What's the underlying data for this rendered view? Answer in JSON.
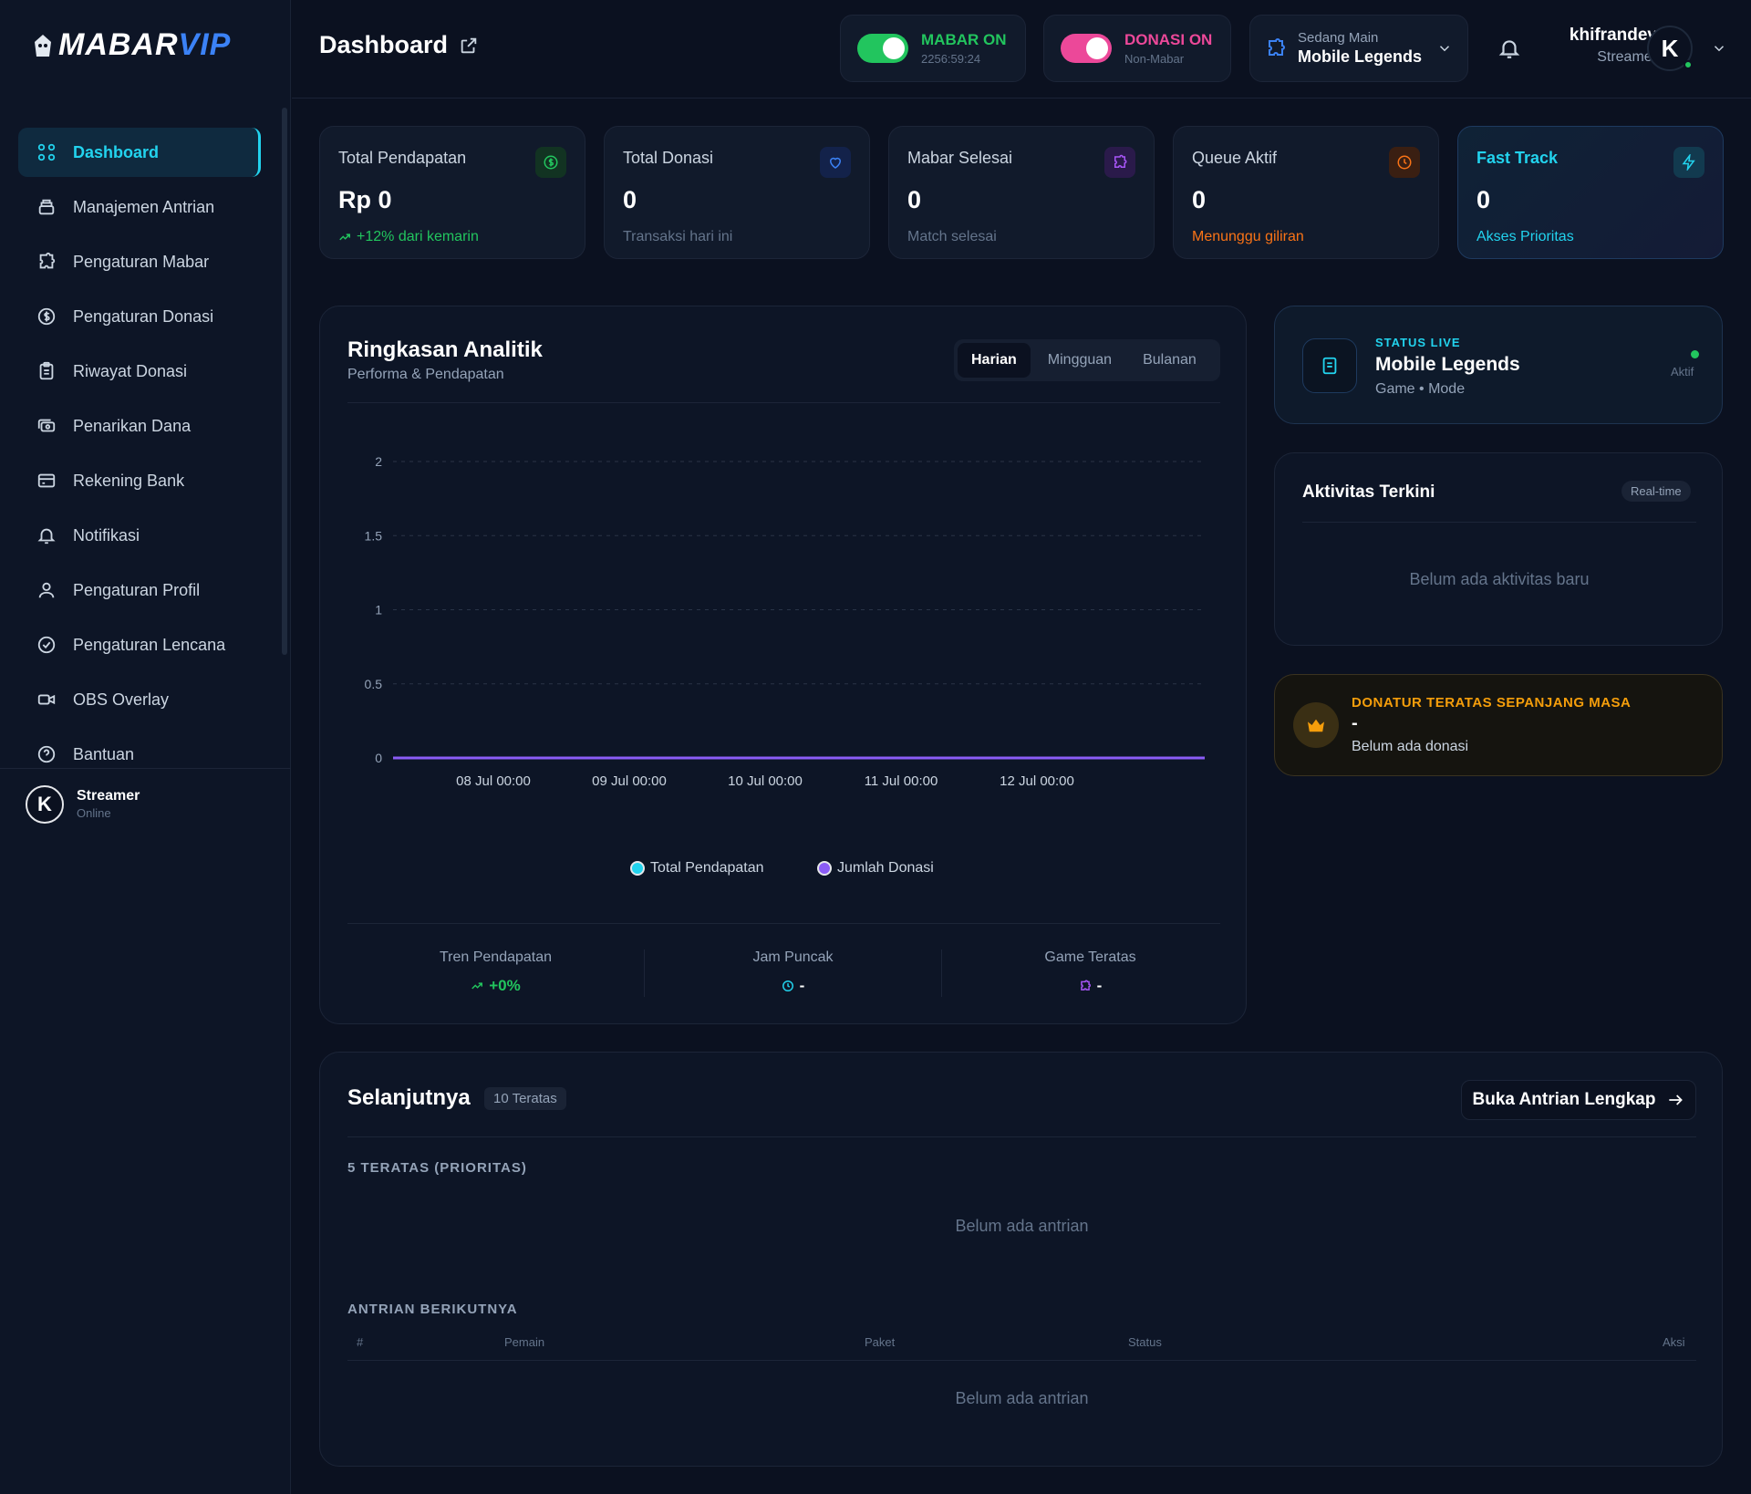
{
  "brand": {
    "logo_a": "MABAR",
    "logo_b": "VIP"
  },
  "sidebar": {
    "items": [
      {
        "label": "Dashboard",
        "icon": "grid-icon"
      },
      {
        "label": "Manajemen Antrian",
        "icon": "stack-icon"
      },
      {
        "label": "Pengaturan Mabar",
        "icon": "puzzle-icon"
      },
      {
        "label": "Pengaturan Donasi",
        "icon": "dollar-circle-icon"
      },
      {
        "label": "Riwayat Donasi",
        "icon": "clipboard-icon"
      },
      {
        "label": "Penarikan Dana",
        "icon": "cash-icon"
      },
      {
        "label": "Rekening Bank",
        "icon": "card-icon"
      },
      {
        "label": "Notifikasi",
        "icon": "bell-icon"
      },
      {
        "label": "Pengaturan Profil",
        "icon": "user-icon"
      },
      {
        "label": "Pengaturan Lencana",
        "icon": "badge-check-icon"
      },
      {
        "label": "OBS Overlay",
        "icon": "video-icon"
      },
      {
        "label": "Bantuan",
        "icon": "help-icon"
      }
    ],
    "user": {
      "name": "Streamer",
      "status": "Online"
    }
  },
  "header": {
    "title": "Dashboard",
    "mabar": {
      "label": "MABAR ON",
      "sub": "2256:59:24"
    },
    "donasi": {
      "label": "DONASI ON",
      "sub": "Non-Mabar"
    },
    "game": {
      "label": "Sedang Main",
      "value": "Mobile Legends"
    },
    "user": {
      "name": "khifrandev",
      "role": "Streamer"
    },
    "avatar_letter": "K"
  },
  "stats": [
    {
      "title": "Total Pendapatan",
      "value": "Rp 0",
      "sub": "+12% dari kemarin"
    },
    {
      "title": "Total Donasi",
      "value": "0",
      "sub": "Transaksi hari ini"
    },
    {
      "title": "Mabar Selesai",
      "value": "0",
      "sub": "Match selesai"
    },
    {
      "title": "Queue Aktif",
      "value": "0",
      "sub": "Menunggu giliran"
    },
    {
      "title": "Fast Track",
      "value": "0",
      "sub": "Akses Prioritas"
    }
  ],
  "analytics": {
    "title": "Ringkasan Analitik",
    "subtitle": "Performa & Pendapatan",
    "tabs": [
      "Harian",
      "Mingguan",
      "Bulanan"
    ],
    "active_tab": "Harian",
    "kpis": [
      {
        "label": "Tren Pendapatan",
        "value": "+0%"
      },
      {
        "label": "Jam Puncak",
        "value": "-"
      },
      {
        "label": "Game Teratas",
        "value": "-"
      }
    ]
  },
  "chart_data": {
    "type": "line",
    "x": [
      "08 Jul 00:00",
      "09 Jul 00:00",
      "10 Jul 00:00",
      "11 Jul 00:00",
      "12 Jul 00:00"
    ],
    "y_ticks": [
      "0",
      "0.5",
      "1",
      "1.5",
      "2"
    ],
    "ylim": [
      0,
      2
    ],
    "grid": true,
    "legend_placement": "bottom",
    "series": [
      {
        "name": "Total Pendapatan",
        "color": "#22d3ee",
        "values": [
          0,
          0,
          0,
          0,
          0
        ]
      },
      {
        "name": "Jumlah Donasi",
        "color": "#8b5cf6",
        "values": [
          0,
          0,
          0,
          0,
          0
        ]
      }
    ]
  },
  "live": {
    "label": "STATUS LIVE",
    "game": "Mobile Legends",
    "mode": "Game • Mode",
    "status": "Aktif"
  },
  "activity": {
    "title": "Aktivitas Terkini",
    "badge": "Real-time",
    "empty": "Belum ada aktivitas baru"
  },
  "top_donor": {
    "label": "DONATUR TERATAS SEPANJANG MASA",
    "name": "-",
    "sub": "Belum ada donasi"
  },
  "next": {
    "title": "Selanjutnya",
    "badge": "10 Teratas",
    "button": "Buka Antrian Lengkap",
    "priority_label": "5 TERATAS (PRIORITAS)",
    "priority_empty": "Belum ada antrian",
    "queue_label": "ANTRIAN BERIKUTNYA",
    "columns": [
      "#",
      "Pemain",
      "Paket",
      "Status",
      "Aksi"
    ],
    "queue_empty": "Belum ada antrian"
  },
  "colors": {
    "accent": "#22d3ee",
    "green": "#22c55e",
    "pink": "#ec4899",
    "orange": "#f97316",
    "purple": "#8b5cf6",
    "gold": "#f59e0b"
  }
}
